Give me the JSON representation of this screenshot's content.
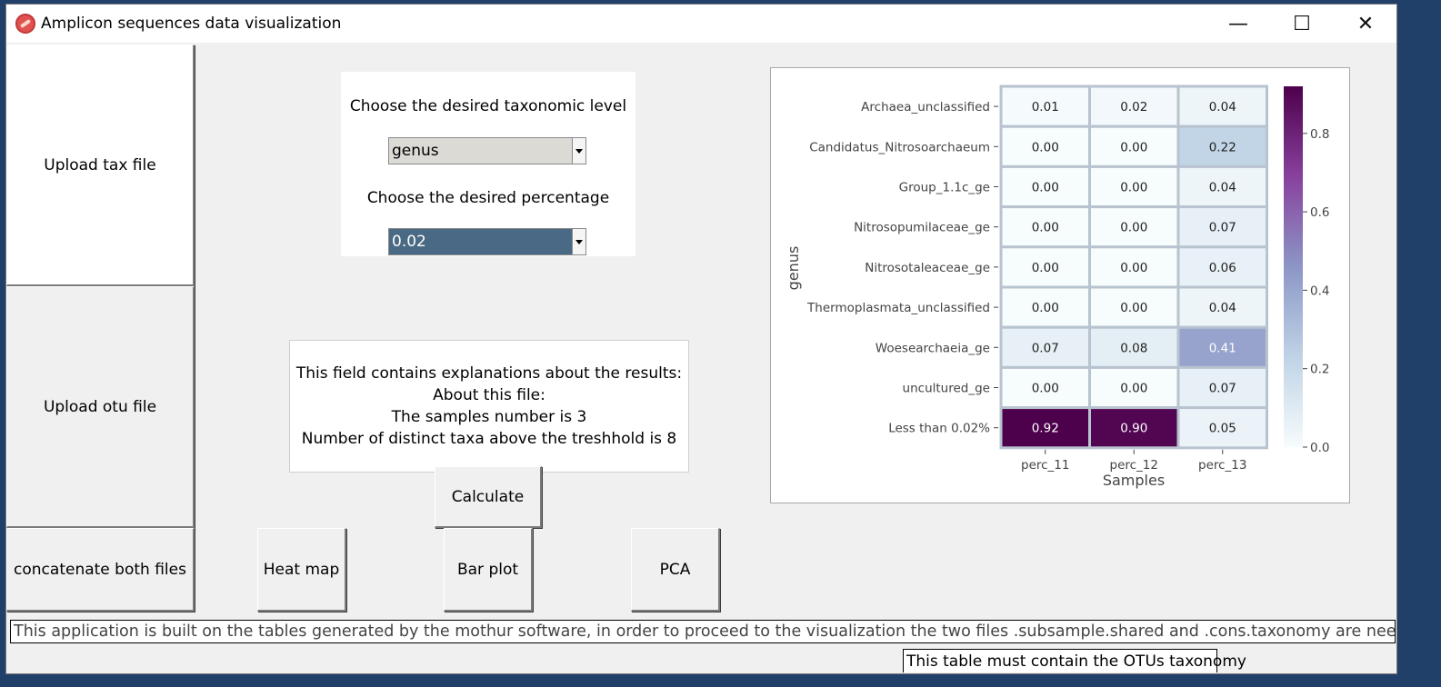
{
  "window": {
    "title": "Amplicon sequences data visualization",
    "controls": {
      "minimize": "—",
      "maximize": "☐",
      "close": "✕"
    }
  },
  "left_buttons": {
    "upload_tax": "Upload tax file",
    "upload_otu": "Upload otu file",
    "concatenate": "concatenate both files"
  },
  "taxonomy_panel": {
    "level_label": "Choose the desired taxonomic level",
    "level_value": "genus",
    "percentage_label": "Choose the desired percentage",
    "percentage_value": "0.02"
  },
  "explanation": {
    "lines": [
      "This field contains explanations about the results:",
      "About this file:",
      "The samples number is 3",
      "Number of distinct taxa above the treshhold is 8"
    ]
  },
  "actions": {
    "calculate": "Calculate",
    "heat_map": "Heat map",
    "bar_plot": "Bar plot",
    "pca": "PCA"
  },
  "status": {
    "info": "This application is built on the tables generated by the mothur software, in order to proceed to the visualization the two files .subsample.shared and .cons.taxonomy are needed",
    "tooltip": "This table must contain the OTUs taxonomy"
  },
  "chart_data": {
    "type": "heatmap",
    "xlabel": "Samples",
    "ylabel": "genus",
    "columns": [
      "perc_11",
      "perc_12",
      "perc_13"
    ],
    "rows": [
      "Archaea_unclassified",
      "Candidatus_Nitrosoarchaeum",
      "Group_1.1c_ge",
      "Nitrosopumilaceae_ge",
      "Nitrosotaleaceae_ge",
      "Thermoplasmata_unclassified",
      "Woesearchaeia_ge",
      "uncultured_ge",
      "Less than 0.02%"
    ],
    "values": [
      [
        0.01,
        0.02,
        0.04
      ],
      [
        0.0,
        0.0,
        0.22
      ],
      [
        0.0,
        0.0,
        0.04
      ],
      [
        0.0,
        0.0,
        0.07
      ],
      [
        0.0,
        0.0,
        0.06
      ],
      [
        0.0,
        0.0,
        0.04
      ],
      [
        0.07,
        0.08,
        0.41
      ],
      [
        0.0,
        0.0,
        0.07
      ],
      [
        0.92,
        0.9,
        0.05
      ]
    ],
    "colorbar": {
      "range": [
        0.0,
        0.92
      ],
      "ticks": [
        0.0,
        0.2,
        0.4,
        0.6,
        0.8
      ],
      "colors": [
        "#f7fcfd",
        "#bfd3e6",
        "#8c96c6",
        "#88419d",
        "#4d004b"
      ]
    }
  }
}
